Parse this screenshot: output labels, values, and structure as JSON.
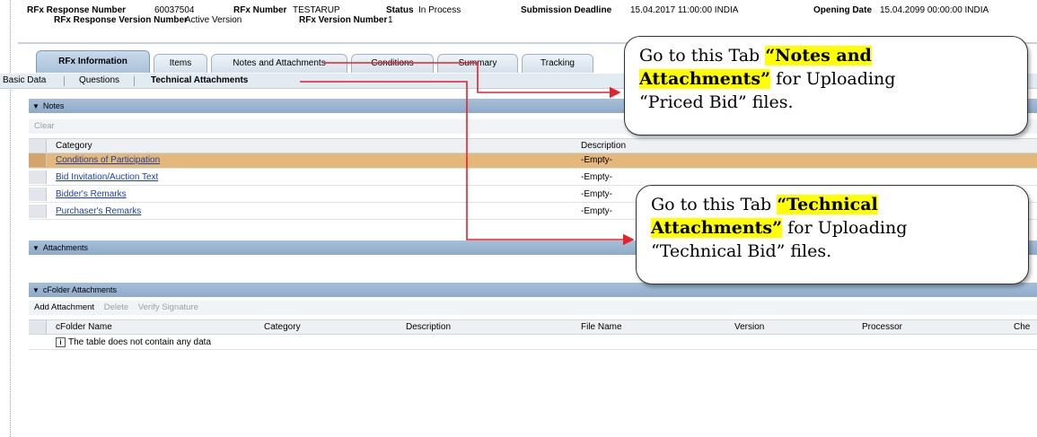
{
  "header": {
    "rfx_response_number_label": "RFx Response Number",
    "rfx_response_number": "60037504",
    "rfx_number_label": "RFx Number",
    "rfx_number": "TESTARUP",
    "status_label": "Status",
    "status": "In Process",
    "submission_deadline_label": "Submission Deadline",
    "submission_deadline": "15.04.2017 11:00:00 INDIA",
    "opening_date_label": "Opening Date",
    "opening_date": "15.04.2099 00:00:00 INDIA",
    "response_version_label": "RFx Response Version Number",
    "response_version": "Active Version",
    "rfx_version_label": "RFx Version Number",
    "rfx_version": "1"
  },
  "tabs": [
    {
      "label": "RFx Information",
      "active": true
    },
    {
      "label": "Items"
    },
    {
      "label": "Notes and Attachments"
    },
    {
      "label": "Conditions"
    },
    {
      "label": "Summary"
    },
    {
      "label": "Tracking"
    }
  ],
  "subnav": [
    "Basic Data",
    "Questions",
    "Technical Attachments"
  ],
  "notes": {
    "title": "Notes",
    "clear_label": "Clear",
    "col_category": "Category",
    "col_description": "Description",
    "rows": [
      {
        "category": "Conditions of Participation",
        "description": "-Empty-"
      },
      {
        "category": "Bid Invitation/Auction Text",
        "description": "-Empty-"
      },
      {
        "category": "Bidder's Remarks",
        "description": "-Empty-"
      },
      {
        "category": "Purchaser's Remarks",
        "description": "-Empty-"
      }
    ]
  },
  "attachments": {
    "title": "Attachments"
  },
  "cfolder": {
    "title": "cFolder Attachments",
    "toolbar": {
      "add": "Add Attachment",
      "delete": "Delete",
      "verify": "Verify Signature"
    },
    "columns": [
      "cFolder Name",
      "Category",
      "Description",
      "File Name",
      "Version",
      "Processor",
      "Che"
    ],
    "empty_message": "The table does not contain any data"
  },
  "callouts": {
    "notes": {
      "prefix": "Go to this Tab ",
      "hl_line1": "“Notes and",
      "hl_line2": "Attachments”",
      "suffix": " for Uploading",
      "line3": "“Priced Bid” files."
    },
    "technical": {
      "prefix": "Go to this Tab ",
      "hl_line1": "“Technical",
      "hl_line2": "Attachments”",
      "suffix": " for Uploading",
      "line3": "“Technical Bid” files."
    }
  },
  "colors": {
    "arrow": "#e8202a",
    "highlight": "#ffff00",
    "section_bar": "#9fb9d3",
    "selected_row": "#e4b77a"
  }
}
